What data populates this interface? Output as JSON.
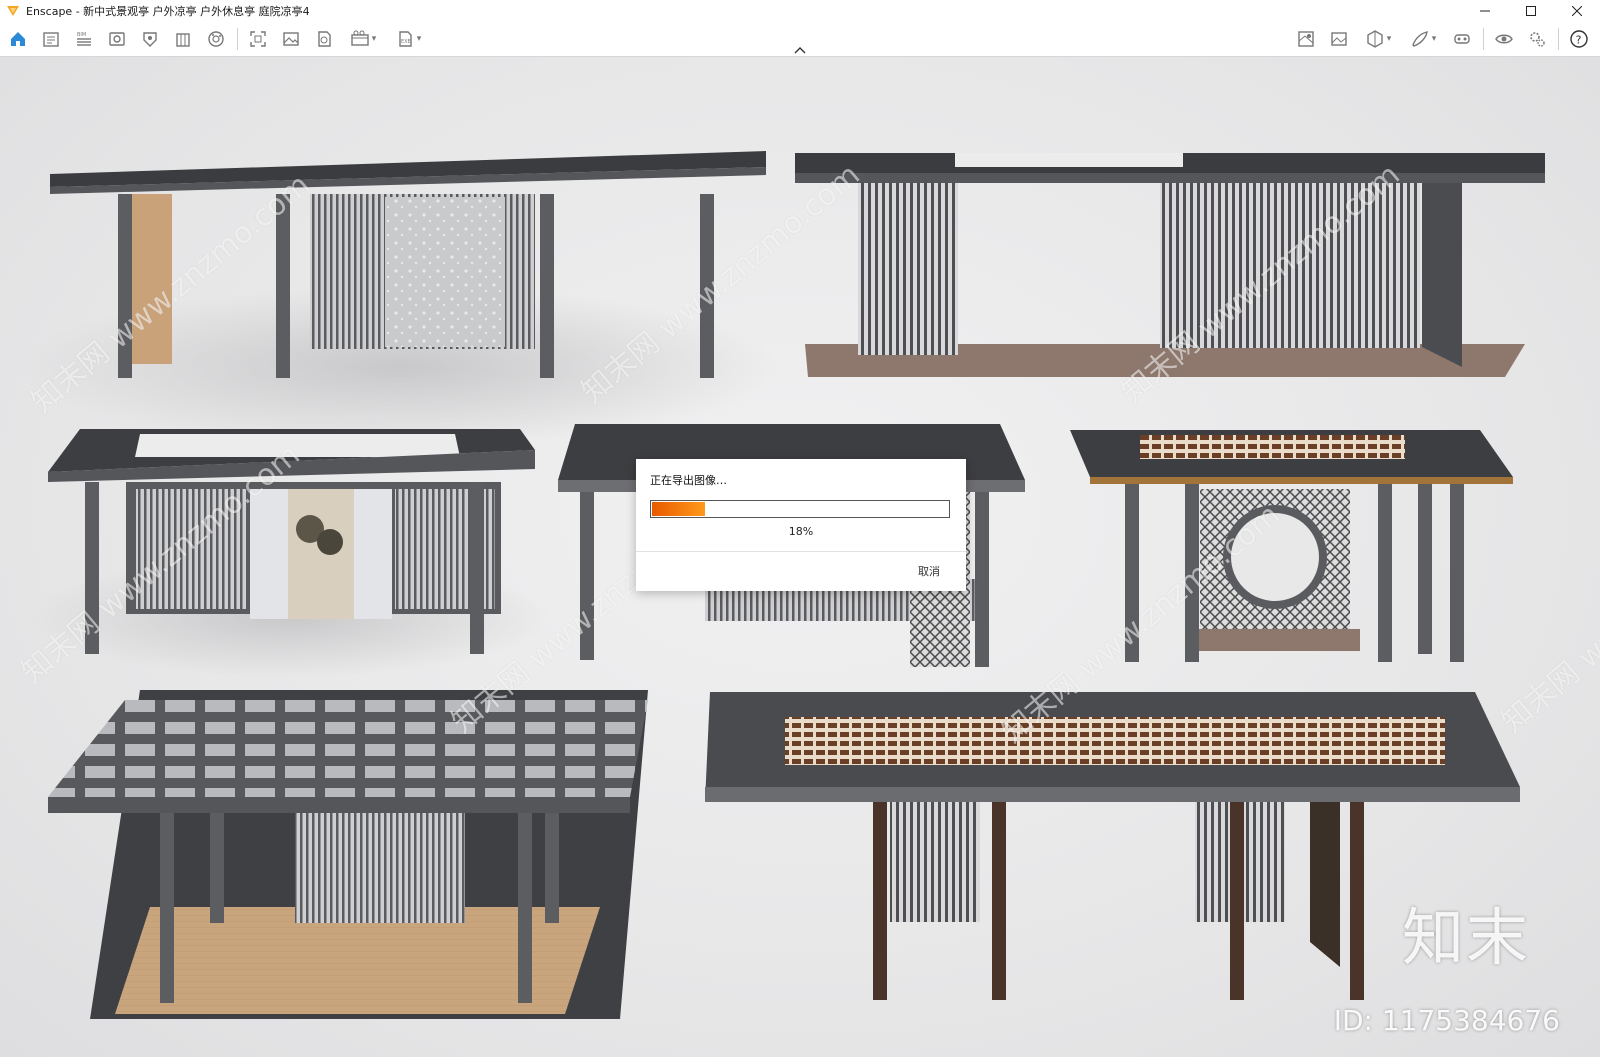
{
  "window": {
    "title": "Enscape - 新中式景观亭 户外凉亭 户外休息亭 庭院凉亭4",
    "controls": [
      "minimize",
      "maximize",
      "close"
    ]
  },
  "toolbar": {
    "left_icons": [
      "home-icon",
      "asset-library-icon",
      "bim-icon",
      "views-icon",
      "visual-settings-icon",
      "building-icon",
      "material-icon",
      "screenshot-icon",
      "render-icon",
      "panorama-icon",
      "video-icon",
      "export-icon"
    ],
    "right_icons": [
      "map-icon",
      "image-icon",
      "section-icon",
      "brush-icon",
      "vr-icon",
      "eye-icon",
      "settings-icon",
      "help-icon"
    ],
    "accent": "#2b8ad8"
  },
  "dialog": {
    "title": "正在导出图像…",
    "progress": 0.18,
    "progress_label": "18%",
    "cancel_label": "取消",
    "progress_colors": [
      "#e85a00",
      "#ff9a1a"
    ]
  },
  "watermark": {
    "diagonal_text": "知末网 www.znzmo.com",
    "brand": "知末",
    "id_text": "ID: 1175384676"
  }
}
